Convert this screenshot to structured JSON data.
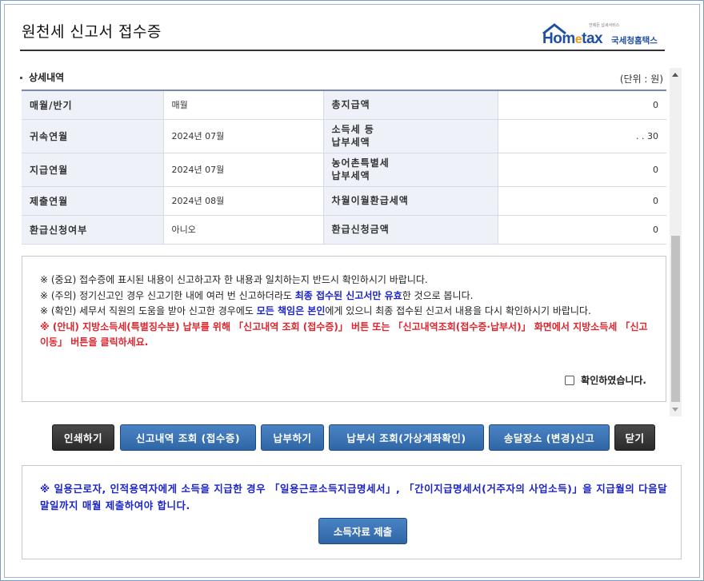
{
  "header": {
    "title": "원천세 신고서 접수증",
    "logo_tagline": "언제든 납세서비스",
    "logo_brand_pre": "Hom",
    "logo_brand_e": "e",
    "logo_brand_post": "tax",
    "logo_korean": "국세청홈택스"
  },
  "detail": {
    "section_title": "상세내역",
    "unit": "(단위 : 원)",
    "rows": [
      {
        "label1": "매월/반기",
        "value1": "매월",
        "label2": "총지급액",
        "value2": "0"
      },
      {
        "label1": "귀속연월",
        "value1": "2024년 07월",
        "label2": "소득세 등\n납부세액",
        "value2": ". . 30"
      },
      {
        "label1": "지급연월",
        "value1": "2024년 07월",
        "label2": "농어촌특별세\n납부세액",
        "value2": "0"
      },
      {
        "label1": "제출연월",
        "value1": "2024년 08월",
        "label2": "차월이월환급세액",
        "value2": "0"
      },
      {
        "label1": "환급신청여부",
        "value1": "아니오",
        "label2": "환급신청금액",
        "value2": "0"
      }
    ]
  },
  "notice": {
    "line1": "※ (중요) 접수증에 표시된 내용이 신고하고자 한 내용과 일치하는지 반드시 확인하시기 바랍니다.",
    "line2_a": "※ (주의) 정기신고인 경우 신고기한 내에 여러 번 신고하더라도 ",
    "line2_b": "최종 접수된 신고서만 유효",
    "line2_c": "한 것으로 봅니다.",
    "line3_a": "※ (확인) 세무서 직원의 도움을 받아 신고한 경우에도 ",
    "line3_b": "모든 책임은 본인",
    "line3_c": "에게 있으니 최종 접수된 신고서 내용을 다시 확인하시기 바랍니다.",
    "line4": "※ (안내) 지방소득세(특별징수분) 납부를 위해 「신고내역 조회 (접수증)」 버튼 또는 「신고내역조회(접수증·납부서)」 화면에서 지방소득세 「신고이동」 버튼을 클릭하세요.",
    "confirm_label": "확인하였습니다."
  },
  "buttons": {
    "print": "인쇄하기",
    "history": "신고내역 조회 (접수증)",
    "pay": "납부하기",
    "bill": "납부서 조회(가상계좌확인)",
    "delivery": "송달장소 (변경)신고",
    "close": "닫기"
  },
  "bottom": {
    "text": "※ 일용근로자, 인적용역자에게 소득을 지급한 경우 「일용근로소득지급명세서」, 「간이지급명세서(거주자의 사업소득)」을 지급월의 다음달 말일까지 매월 제출하여야 합니다.",
    "submit_label": "소득자료 제출"
  },
  "colors": {
    "accent_blue": "#2f66a6",
    "notice_blue": "#1b24c9",
    "notice_red": "#e1242c",
    "header_bg": "#eef2f8"
  }
}
